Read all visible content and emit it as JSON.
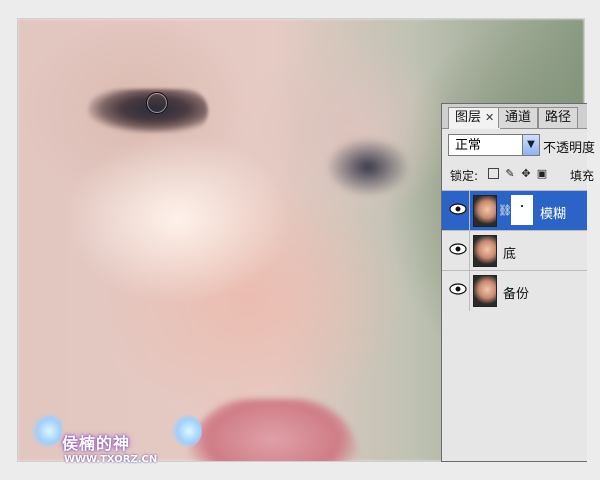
{
  "watermark": {
    "title": "侯楠的神",
    "url": "WWW.TXORZ.CN"
  },
  "layers_panel": {
    "tabs": [
      {
        "label": "图层",
        "active": true,
        "closable": true
      },
      {
        "label": "通道",
        "active": false
      },
      {
        "label": "路径",
        "active": false
      }
    ],
    "blend_mode": "正常",
    "opacity_label": "不透明度",
    "lock_label": "锁定:",
    "fill_label": "填充",
    "layers": [
      {
        "name": "模糊",
        "selected": true,
        "has_mask": true,
        "visible": true
      },
      {
        "name": "底",
        "selected": false,
        "has_mask": false,
        "visible": true
      },
      {
        "name": "备份",
        "selected": false,
        "has_mask": false,
        "visible": true
      }
    ]
  },
  "colors": {
    "selection": "#2b63c7",
    "panel_bg": "#e6e6e6"
  }
}
